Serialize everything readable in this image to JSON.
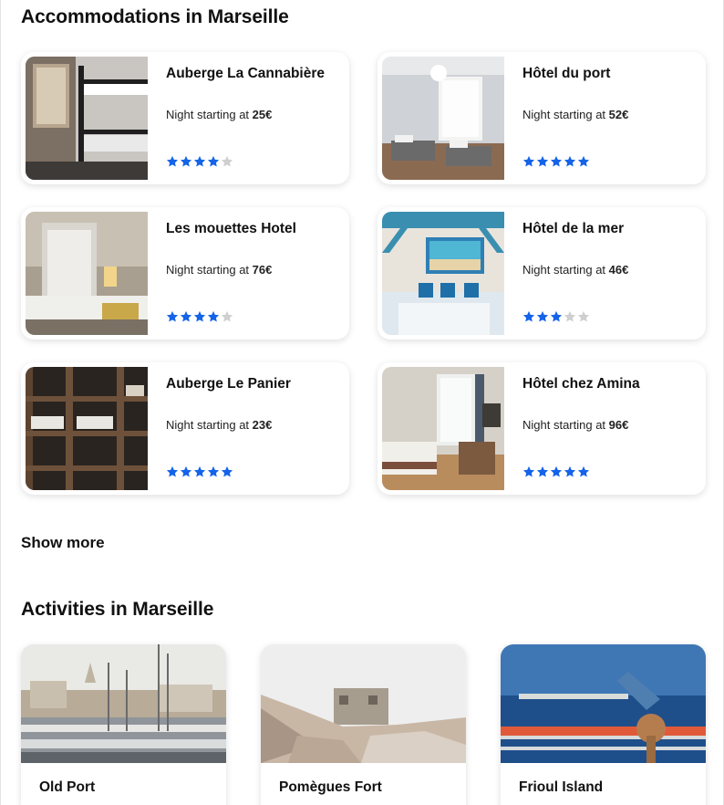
{
  "accommodations": {
    "title": "Accommodations in Marseille",
    "price_prefix": "Night starting at",
    "items": [
      {
        "name": "Auberge La Cannabière",
        "price": "25€",
        "rating": 4,
        "max_rating": 5
      },
      {
        "name": "Hôtel du port",
        "price": "52€",
        "rating": 5,
        "max_rating": 5
      },
      {
        "name": "Les mouettes Hotel",
        "price": "76€",
        "rating": 4,
        "max_rating": 5
      },
      {
        "name": "Hôtel de la mer",
        "price": "46€",
        "rating": 3,
        "max_rating": 5
      },
      {
        "name": "Auberge Le Panier",
        "price": "23€",
        "rating": 5,
        "max_rating": 5
      },
      {
        "name": "Hôtel chez Amina",
        "price": "96€",
        "rating": 5,
        "max_rating": 5
      }
    ],
    "show_more_label": "Show more"
  },
  "activities": {
    "title": "Activities in Marseille",
    "items": [
      {
        "name": "Old Port"
      },
      {
        "name": "Pomègues Fort"
      },
      {
        "name": "Frioul Island"
      }
    ]
  },
  "colors": {
    "star_on": "#1463e8",
    "star_off": "#cfcfcf"
  },
  "icons": {
    "rating": "star-icon"
  }
}
